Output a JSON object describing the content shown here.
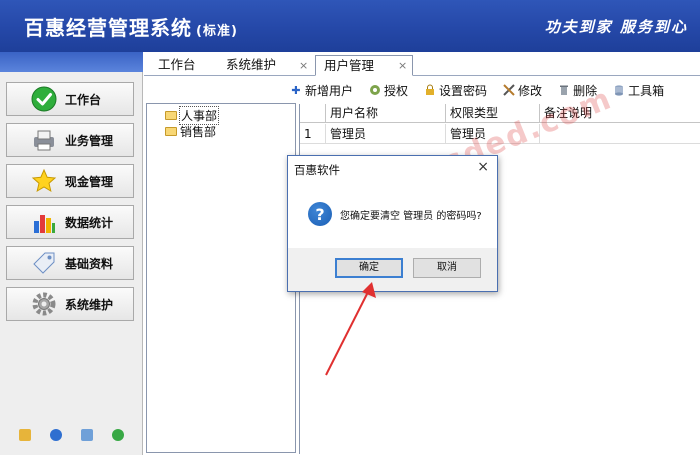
{
  "app": {
    "title": "百惠经营管理系统",
    "edition": "(标准)",
    "slogan": "功夫到家 服务到心"
  },
  "sidebar": {
    "items": [
      {
        "label": "工作台",
        "icon": "check-circle-icon"
      },
      {
        "label": "业务管理",
        "icon": "printer-icon"
      },
      {
        "label": "现金管理",
        "icon": "star-icon"
      },
      {
        "label": "数据统计",
        "icon": "bar-chart-icon"
      },
      {
        "label": "基础资料",
        "icon": "tag-icon"
      },
      {
        "label": "系统维护",
        "icon": "gear-icon"
      }
    ],
    "bottom_icons": [
      "edit-icon",
      "clock-icon",
      "search-icon",
      "refresh-icon"
    ]
  },
  "tabs": [
    {
      "label": "工作台"
    },
    {
      "label": "系统维护",
      "close": "×"
    },
    {
      "label": "用户管理",
      "close": "×"
    }
  ],
  "toolbar": {
    "add_user": "新增用户",
    "authorize": "授权",
    "set_password": "设置密码",
    "edit": "修改",
    "delete": "删除",
    "toolbox": "工具箱"
  },
  "tree": {
    "items": [
      "人事部",
      "销售部"
    ]
  },
  "grid": {
    "columns": [
      "用户名称",
      "权限类型",
      "备注说明"
    ],
    "rows": [
      {
        "index": "1",
        "name": "管理员",
        "role": "管理员",
        "note": ""
      }
    ]
  },
  "watermark": "www.hassded.com",
  "dialog": {
    "title": "百惠软件",
    "close": "×",
    "icon": "question-icon",
    "message": "您确定要清空 管理员 的密码吗?",
    "ok": "确定",
    "cancel": "取消"
  }
}
